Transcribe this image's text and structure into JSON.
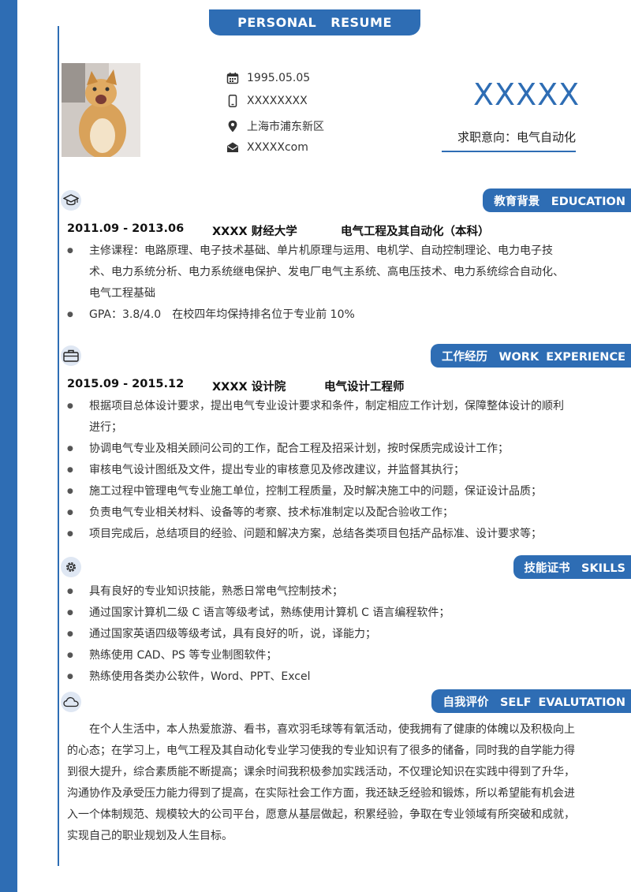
{
  "header": {
    "tab_label": "PERSONAL  RESUME"
  },
  "profile": {
    "birth": "1995.05.05",
    "phone": "XXXXXXXX",
    "location": "上海市浦东新区",
    "email": "XXXXXcom",
    "name": "XXXXX",
    "job_intent": "求职意向：电气自动化",
    "icons": [
      "calendar-icon",
      "phone-icon",
      "location-pin-icon",
      "envelope-icon"
    ]
  },
  "sections": {
    "education": {
      "title": "教育背景　EDUCATION",
      "date": "2011.09 - 2013.06",
      "school": "XXXX 财经大学",
      "major": "电气工程及其自动化（本科）",
      "items": [
        "主修课程：电路原理、电子技术基础、单片机原理与运用、电机学、自动控制理论、电力电子技术、电力系统分析、电力系统继电保护、发电厂电气主系统、高电压技术、电力系统综合自动化、电气工程基础",
        "GPA：3.8/4.0　在校四年均保持排名位于专业前 10%"
      ]
    },
    "work": {
      "title": "工作经历　WORK EXPERIENCE",
      "date": "2015.09 - 2015.12",
      "company": "XXXX 设计院",
      "position": "电气设计工程师",
      "items": [
        "根据项目总体设计要求，提出电气专业设计要求和条件，制定相应工作计划，保障整体设计的顺利进行；",
        "协调电气专业及相关顾问公司的工作，配合工程及招采计划，按时保质完成设计工作；",
        "审核电气设计图纸及文件，提出专业的审核意见及修改建议，并监督其执行；",
        "施工过程中管理电气专业施工单位，控制工程质量，及时解决施工中的问题，保证设计品质；",
        "负责电气专业相关材料、设备等的考察、技术标准制定以及配合验收工作；",
        "项目完成后，总结项目的经验、问题和解决方案，总结各类项目包括产品标准、设计要求等；"
      ]
    },
    "skills": {
      "title": "技能证书　SKILLS",
      "items": [
        "具有良好的专业知识技能，熟悉日常电气控制技术；",
        "通过国家计算机二级 C 语言等级考试，熟练使用计算机 C 语言编程软件；",
        "通过国家英语四级等级考试，具有良好的听，说，译能力；",
        "熟练使用 CAD、PS 等专业制图软件；",
        "熟练使用各类办公软件，Word、PPT、Excel"
      ]
    },
    "self": {
      "title": "自我评价　SELF EVALUTATION",
      "text": "在个人生活中，本人热爱旅游、看书，喜欢羽毛球等有氧活动，使我拥有了健康的体魄以及积极向上的心态；在学习上，电气工程及其自动化专业学习使我的专业知识有了很多的储备，同时我的自学能力得到很大提升，综合素质能不断提高；课余时间我积极参加实践活动，不仅理论知识在实践中得到了升华，沟通协作及承受压力能力得到了提高，在实际社会工作方面，我还缺乏经验和锻炼，所以希望能有机会进入一个体制规范、规模较大的公司平台，愿意从基层做起，积累经验，争取在专业领域有所突破和成就，实现自己的职业规划及人生目标。"
    }
  },
  "colors": {
    "accent": "#2e6db4",
    "icon_bg": "#dfe7f3"
  }
}
